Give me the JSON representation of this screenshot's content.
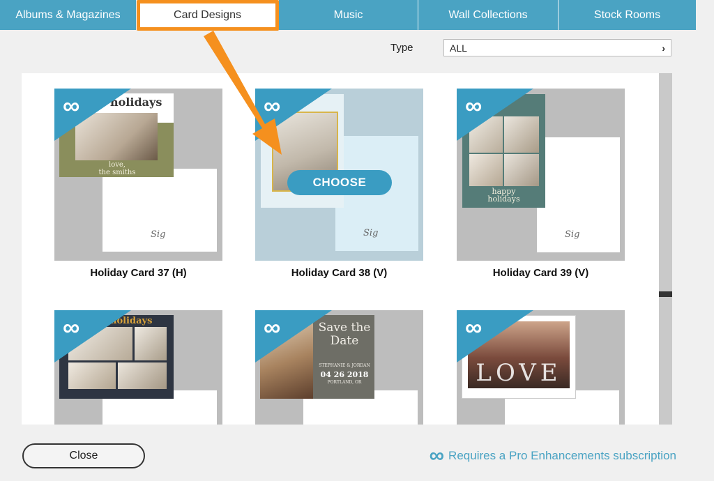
{
  "tabs": [
    {
      "label": "Albums & Magazines"
    },
    {
      "label": "Card Designs"
    },
    {
      "label": "Music"
    },
    {
      "label": "Wall Collections"
    },
    {
      "label": "Stock Rooms"
    }
  ],
  "filter": {
    "label": "Type",
    "value": "ALL"
  },
  "cards": [
    {
      "title": "Holiday Card 37 (H)",
      "headline": "holidays",
      "caption": "love,\nthe smiths"
    },
    {
      "title": "Holiday Card 38 (V)",
      "action": "CHOOSE"
    },
    {
      "title": "Holiday Card 39 (V)",
      "caption": "happy holidays"
    },
    {
      "headline": "holidays"
    },
    {
      "script": "Save the Date",
      "names": "STEPHANIE & JORDAN",
      "date": "04 26 2018",
      "place": "PORTLAND, OR"
    },
    {
      "word": "LOVE"
    }
  ],
  "footer": {
    "close_label": "Close",
    "pro_note": "Requires a Pro Enhancements subscription"
  },
  "colors": {
    "accent": "#4aa3c3",
    "highlight": "#f5901e"
  },
  "icons": {
    "pro": "infinity-icon",
    "select": "chevron-right-icon"
  }
}
